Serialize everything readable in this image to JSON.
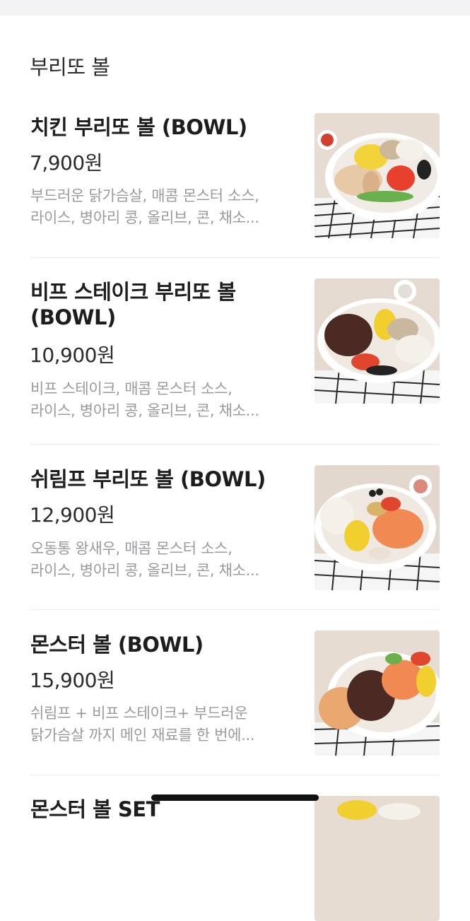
{
  "section": {
    "title": "부리또 볼"
  },
  "items": [
    {
      "name": "치킨 부리또 볼 (BOWL)",
      "price": "7,900원",
      "desc1": "부드러운 닭가슴살, 매콤 몬스터 소스,",
      "desc2": "라이스, 병아리 콩, 올리브, 콘, 채소..."
    },
    {
      "name1": "비프 스테이크 부리또 볼",
      "name2": "(BOWL)",
      "price": "10,900원",
      "desc1": "비프 스테이크, 매콤 몬스터 소스,",
      "desc2": "라이스, 병아리 콩, 올리브, 콘, 채소..."
    },
    {
      "name": "쉬림프 부리또 볼  (BOWL)",
      "price": "12,900원",
      "desc1": "오동통 왕새우, 매콤 몬스터 소스,",
      "desc2": "라이스, 병아리 콩, 올리브, 콘, 채소..."
    },
    {
      "name": "몬스터 볼 (BOWL)",
      "price": "15,900원",
      "desc1": "쉬림프 + 비프 스테이크+ 부드러운",
      "desc2": "닭가슴살 까지 메인 재료를 한 번에..."
    },
    {
      "name": "몬스터 볼 SET"
    }
  ]
}
